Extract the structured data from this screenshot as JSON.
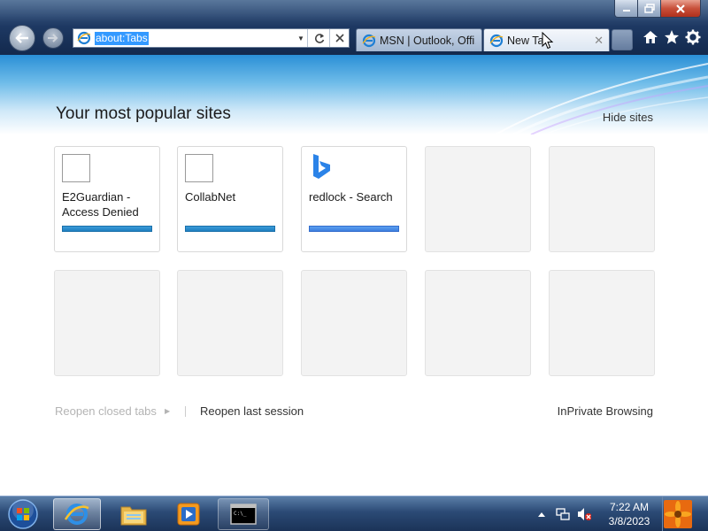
{
  "browser": {
    "address": "about:Tabs",
    "tabs": [
      {
        "label": "MSN | Outlook, Offi…",
        "active": false
      },
      {
        "label": "New Ta",
        "active": true
      }
    ]
  },
  "page": {
    "title": "Your most popular sites",
    "hide_sites": "Hide sites",
    "tiles_row1": [
      {
        "title": "E2Guardian - Access Denied",
        "has_bar": true
      },
      {
        "title": "CollabNet",
        "has_bar": true
      },
      {
        "title": "redlock - Search",
        "has_bar": true
      },
      {
        "title": "",
        "has_bar": false
      },
      {
        "title": "",
        "has_bar": false
      }
    ],
    "footer": {
      "reopen_closed": "Reopen closed tabs",
      "reopen_session": "Reopen last session",
      "inprivate": "InPrivate Browsing"
    }
  },
  "taskbar": {
    "time": "7:22 AM",
    "date": "3/8/2023"
  },
  "colors": {
    "accent": "#1f7fc0",
    "bing": "#3d7fde",
    "taskbar": "#2b4a75"
  }
}
